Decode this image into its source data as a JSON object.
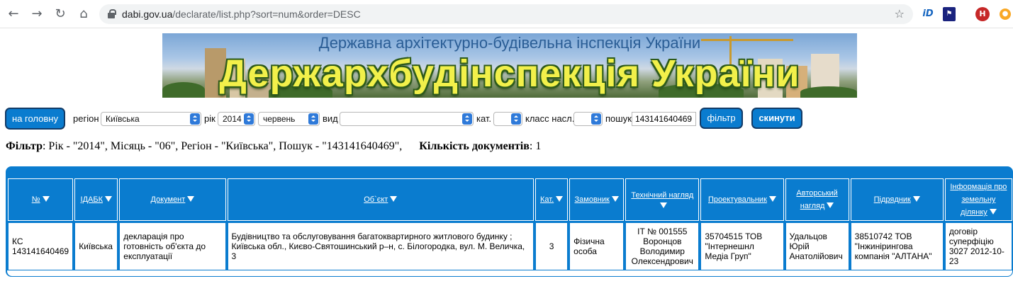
{
  "browser": {
    "url_host": "dabi.gov.ua",
    "url_path": "/declarate/list.php?sort=num&order=DESC",
    "ext_profile_initial": "H",
    "ext_id_label": "iD"
  },
  "banner": {
    "subtitle": "Державна архітектурно-будівельна інспекція України",
    "title": "Держархбудінспекція України"
  },
  "filters": {
    "home_label": "на головну",
    "region_label": "регіон",
    "region_value": "Київська",
    "year_label": "рік",
    "year_value": "2014",
    "month_value": "червень",
    "type_label": "вид",
    "type_value": "",
    "cat_label": "кат.",
    "cat_value": "",
    "class_label": "класс насл.",
    "class_value": "",
    "search_label": "пошук",
    "search_value": "143141640469",
    "filter_label": "фільтр",
    "reset_label": "скинути"
  },
  "summary": {
    "filter_label": "Фільтр",
    "filter_text": ": Рік - \"2014\", Місяць - \"06\", Регіон - \"Київська\", Пошук - \"143141640469\",",
    "count_label": "Кількість документів",
    "count_value": ": 1"
  },
  "table": {
    "headers": [
      "№",
      "ІДАБК",
      "Документ",
      "Об`єкт",
      "Кат.",
      "Замовник",
      "Технічний нагляд",
      "Проектувальник",
      "Авторський нагляд",
      "Підрядник",
      "Інформація про земельну ділянку"
    ],
    "rows": [
      [
        "КС 143141640469",
        "Київська",
        "декларація про готовність об'єкта до експлуатації",
        "Будівництво та обслуговування багатоквартирного житлового будинку ; Київська обл., Києво-Святошинський р–н, с. Білогородка, вул. М. Величка, 3",
        "3",
        "Фізична особа",
        "ІТ № 001555 Воронцов Володимир Олексендрович",
        "35704515 ТОВ \"Інтернешнл Медіа Груп\"",
        "Удальцов Юрій Анатолійович",
        "38510742 ТОВ \"Інжинірингова компанія \"АЛТАНА\"",
        "договір суперфіцію 3027 2012-10-23"
      ]
    ]
  },
  "colors": {
    "accent": "#0a7ccf",
    "title_yellow": "#f2f04a"
  }
}
